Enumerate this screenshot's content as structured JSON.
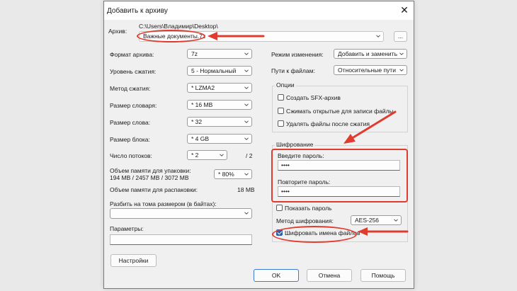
{
  "window": {
    "title": "Добавить к архиву",
    "close_glyph": "✕"
  },
  "archive": {
    "label": "Архив:",
    "path": "C:\\Users\\Владимир\\Desktop\\",
    "filename": "Важные документы.7z",
    "browse_label": "..."
  },
  "left": {
    "format": {
      "label": "Формат архива:",
      "value": "7z"
    },
    "level": {
      "label": "Уровень сжатия:",
      "value": "5 - Нормальный"
    },
    "method": {
      "label": "Метод сжатия:",
      "value": "* LZMA2"
    },
    "dict": {
      "label": "Размер словаря:",
      "value": "* 16 MB"
    },
    "word": {
      "label": "Размер слова:",
      "value": "* 32"
    },
    "block": {
      "label": "Размер блока:",
      "value": "* 4 GB"
    },
    "threads": {
      "label": "Число потоков:",
      "value": "* 2",
      "max": "/ 2"
    },
    "mem_pack": {
      "label": "Объем памяти для упаковки:",
      "values": "194 MB / 2457 MB / 3072 MB",
      "percent": "* 80%"
    },
    "mem_unpack": {
      "label": "Объем памяти для распаковки:",
      "value": "18 MB"
    },
    "split": {
      "label": "Разбить на тома размером (в байтах):",
      "value": ""
    },
    "params": {
      "label": "Параметры:",
      "value": ""
    },
    "settings_button": "Настройки"
  },
  "right": {
    "update_mode": {
      "label": "Режим изменения:",
      "value": "Добавить и заменить"
    },
    "path_mode": {
      "label": "Пути к файлам:",
      "value": "Относительные пути"
    },
    "options": {
      "title": "Опции",
      "sfx": "Создать SFX-архив",
      "shared": "Сжимать открытые для записи файлы",
      "delete": "Удалять файлы после сжатия"
    },
    "encryption": {
      "title": "Шифрование",
      "pwd_label": "Введите пароль:",
      "pwd_value": "••••",
      "repeat_label": "Повторите пароль:",
      "repeat_value": "••••",
      "show_pwd": "Показать пароль",
      "method_label": "Метод шифрования:",
      "method_value": "AES-256",
      "encrypt_names": "Шифровать имена файлов"
    }
  },
  "buttons": {
    "ok": "OK",
    "cancel": "Отмена",
    "help": "Помощь"
  },
  "colors": {
    "annotation": "#e03b2f",
    "accent": "#3c7bd3"
  }
}
